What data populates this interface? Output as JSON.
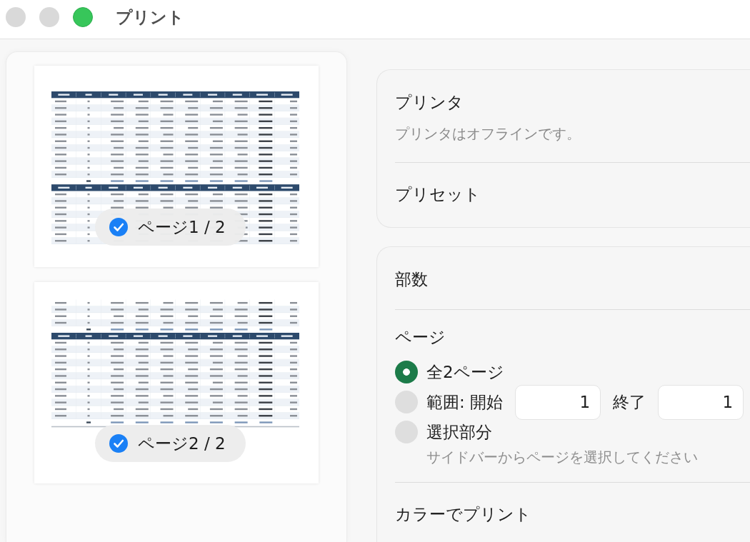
{
  "window": {
    "title": "プリント"
  },
  "sidebar": {
    "pages": [
      {
        "label": "ページ1 / 2",
        "selected": true
      },
      {
        "label": "ページ2 / 2",
        "selected": true
      }
    ]
  },
  "settings": [
    {
      "rows": [
        {
          "kind": "heading",
          "label": "プリンタ",
          "note": "プリンタはオフラインです。"
        },
        {
          "kind": "heading",
          "label": "プリセット"
        }
      ]
    },
    {
      "rows": [
        {
          "kind": "heading",
          "label": "部数"
        },
        {
          "kind": "choice",
          "label": "ページ",
          "options": [
            {
              "kind": "plain",
              "label": "全2ページ",
              "selected": true
            },
            {
              "kind": "range",
              "label": "範囲: 開始",
              "selected": false,
              "from": "1",
              "to_label": "終了",
              "to": "1"
            },
            {
              "kind": "plain",
              "label": "選択部分",
              "selected": false,
              "note": "サイドバーからページを選択してください"
            }
          ]
        },
        {
          "kind": "heading",
          "label": "カラーでプリント"
        }
      ]
    }
  ]
}
